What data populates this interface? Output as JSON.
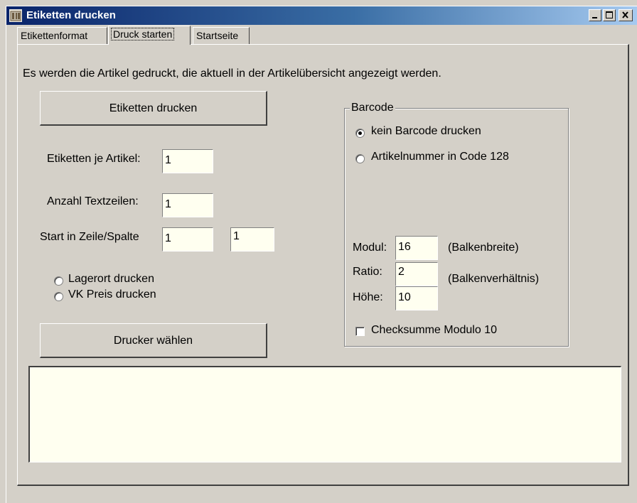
{
  "window": {
    "title": "Etiketten drucken",
    "controls": {
      "minimize": "minimize-icon",
      "maximize": "maximize-icon",
      "close": "close-icon"
    }
  },
  "tabs": [
    {
      "label": "Etikettenformat",
      "active": false
    },
    {
      "label": "Druck starten",
      "active": true
    },
    {
      "label": "Startseite",
      "active": false
    }
  ],
  "main": {
    "info_text": "Es werden die Artikel gedruckt, die aktuell in der Artikelübersicht angezeigt werden.",
    "print_button": "Etiketten drucken",
    "printer_button": "Drucker wählen",
    "labels_per_article": {
      "label": "Etiketten je Artikel:",
      "value": "1"
    },
    "text_lines": {
      "label": "Anzahl Textzeilen:",
      "value": "1"
    },
    "start_pos": {
      "label": "Start in Zeile/Spalte",
      "row": "1",
      "column": "1"
    },
    "options": [
      {
        "label": "Lagerort drucken",
        "checked": false
      },
      {
        "label": "VK Preis drucken",
        "checked": false
      }
    ],
    "log_text": ""
  },
  "barcode": {
    "title": "Barcode",
    "options": [
      {
        "label": "kein Barcode drucken",
        "checked": true
      },
      {
        "label": "Artikelnummer in Code 128",
        "checked": false
      }
    ],
    "modul": {
      "label": "Modul:",
      "value": "16",
      "hint": "(Balkenbreite)"
    },
    "ratio": {
      "label": "Ratio:",
      "value": "2",
      "hint": "(Balkenverhältnis)"
    },
    "height": {
      "label": "Höhe:",
      "value": "10"
    },
    "checksum": {
      "label": "Checksumme Modulo 10",
      "checked": false
    }
  },
  "colors": {
    "title_start": "#0a246a",
    "title_end": "#a6caf0",
    "field_bg": "#fffff0",
    "face": "#d4d0c8"
  }
}
